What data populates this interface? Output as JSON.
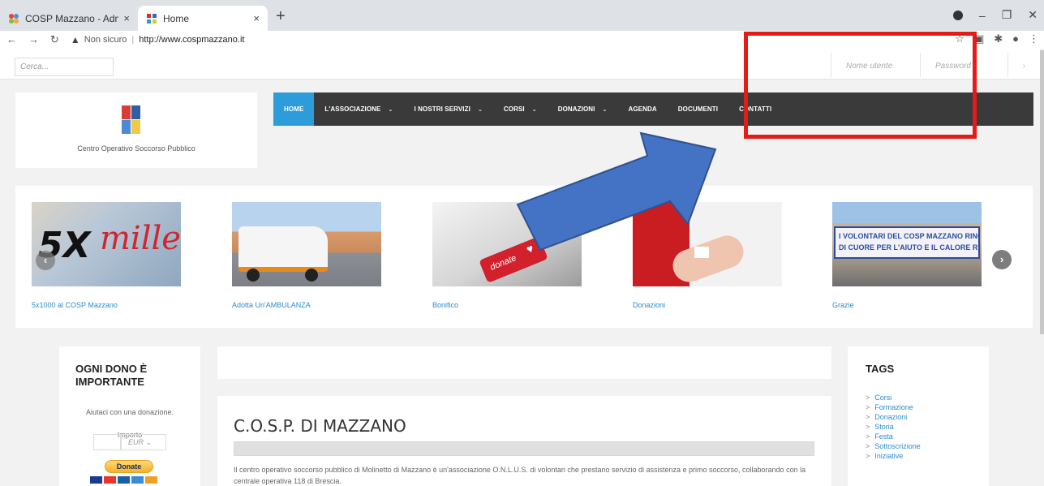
{
  "browser": {
    "tabs": [
      {
        "title": "COSP Mazzano - Administration",
        "close": "×"
      },
      {
        "title": "Home",
        "close": "×"
      }
    ],
    "new_tab": "+",
    "security_label": "Non sicuro",
    "separator": "|",
    "url": "http://www.cospmazzano.it"
  },
  "topbar": {
    "search_placeholder": "Cerca...",
    "username_placeholder": "Nome utente",
    "password_placeholder": "Password",
    "go": "›"
  },
  "logo": {
    "caption": "Centro Operativo Soccorso Pubblico"
  },
  "nav": {
    "items": [
      {
        "label": "HOME"
      },
      {
        "label": "L'ASSOCIAZIONE"
      },
      {
        "label": "I NOSTRI SERVIZI"
      },
      {
        "label": "CORSI"
      },
      {
        "label": "DONAZIONI"
      },
      {
        "label": "AGENDA"
      },
      {
        "label": "DOCUMENTI"
      },
      {
        "label": "CONTATTI"
      }
    ],
    "caret": "⌄"
  },
  "carousel": {
    "slides": [
      {
        "caption": "5x1000 al COSP Mazzano",
        "art_big": "5X",
        "art_red": "mille"
      },
      {
        "caption": "Adotta Un'AMBULANZA"
      },
      {
        "caption": "Bonifico",
        "art_key": "donate"
      },
      {
        "caption": "Donazioni"
      },
      {
        "caption": "Grazie",
        "art_banner_1": "I VOLONTARI DEL COSP MAZZANO RINGRAZIANO",
        "art_banner_2": "DI CUORE PER L'AIUTO E IL CALORE RICEVUTI"
      }
    ],
    "prev": "‹",
    "next": "›"
  },
  "donation_widget": {
    "title": "OGNI DONO È IMPORTANTE",
    "text": "Aiutaci con una donazione.",
    "amount_label": "Importo",
    "currency": "EUR",
    "currency_caret": "⌄",
    "button_label": "Donate"
  },
  "content": {
    "title": "C.O.S.P. DI MAZZANO",
    "text": "Il centro operativo soccorso pubblico di Molinetto di Mazzano è un'associazione O.N.L.U.S. di volontari che prestano servizio di assistenza e primo soccorso, collaborando con la centrale operativa 118 di Brescia."
  },
  "tags_widget": {
    "title": "TAGS",
    "chevron": ">",
    "tags": [
      {
        "label": "Corsi"
      },
      {
        "label": "Formazione"
      },
      {
        "label": "Donazioni"
      },
      {
        "label": "Storia"
      },
      {
        "label": "Festa"
      },
      {
        "label": "Sottoscrizione"
      },
      {
        "label": "Iniziative"
      }
    ]
  },
  "colors": {
    "nav_bg": "#3a3a3a",
    "nav_active": "#2d9cdb",
    "link": "#2d8bc9",
    "annotation_box": "#e41b17",
    "annotation_arrow": "#4472c4"
  }
}
